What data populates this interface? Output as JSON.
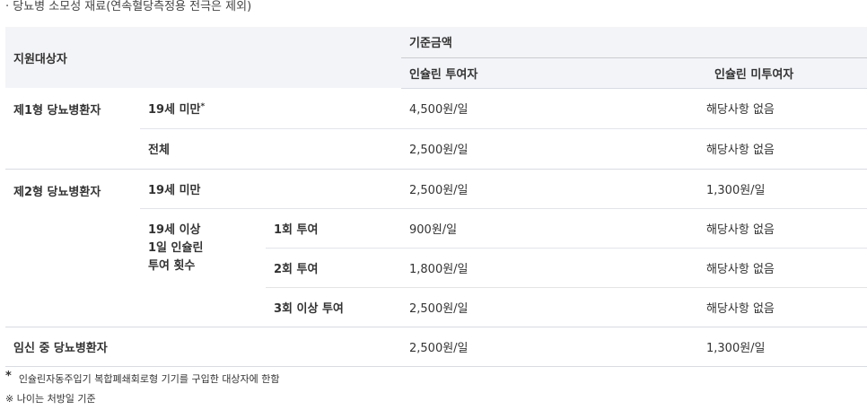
{
  "caption": "· 당뇨병 소모성 재료(연속혈당측정용 전극은 제외)",
  "table": {
    "header": {
      "target": "지원대상자",
      "amount": "기준금액",
      "insulin_user": "인슐린 투여자",
      "non_insulin_user": "인슐린 미투여자"
    },
    "type1": {
      "label": "제1형 당뇨병환자",
      "rows": [
        {
          "sub": "19세 미만",
          "star": "*",
          "insulin": "4,500원/일",
          "non_insulin": "해당사항 없음"
        },
        {
          "sub": "전체",
          "insulin": "2,500원/일",
          "non_insulin": "해당사항 없음"
        }
      ]
    },
    "type2": {
      "label": "제2형 당뇨병환자",
      "under19": {
        "sub": "19세 미만",
        "insulin": "2,500원/일",
        "non_insulin": "1,300원/일"
      },
      "over19_label": "19세 이상\n1일 인슐린\n투여 횟수",
      "over19_rows": [
        {
          "count": "1회 투여",
          "insulin": "900원/일",
          "non_insulin": "해당사항 없음"
        },
        {
          "count": "2회 투여",
          "insulin": "1,800원/일",
          "non_insulin": "해당사항 없음"
        },
        {
          "count": "3회 이상 투여",
          "insulin": "2,500원/일",
          "non_insulin": "해당사항 없음"
        }
      ]
    },
    "pregnant": {
      "label": "임신 중 당뇨병환자",
      "insulin": "2,500원/일",
      "non_insulin": "1,300원/일"
    }
  },
  "notes": {
    "star_mark": "*",
    "star_text": "인슐린자동주입기 복합폐쇄회로형 기기를 구입한 대상자에 한함",
    "age_note": "※ 나이는 처방일 기준"
  }
}
